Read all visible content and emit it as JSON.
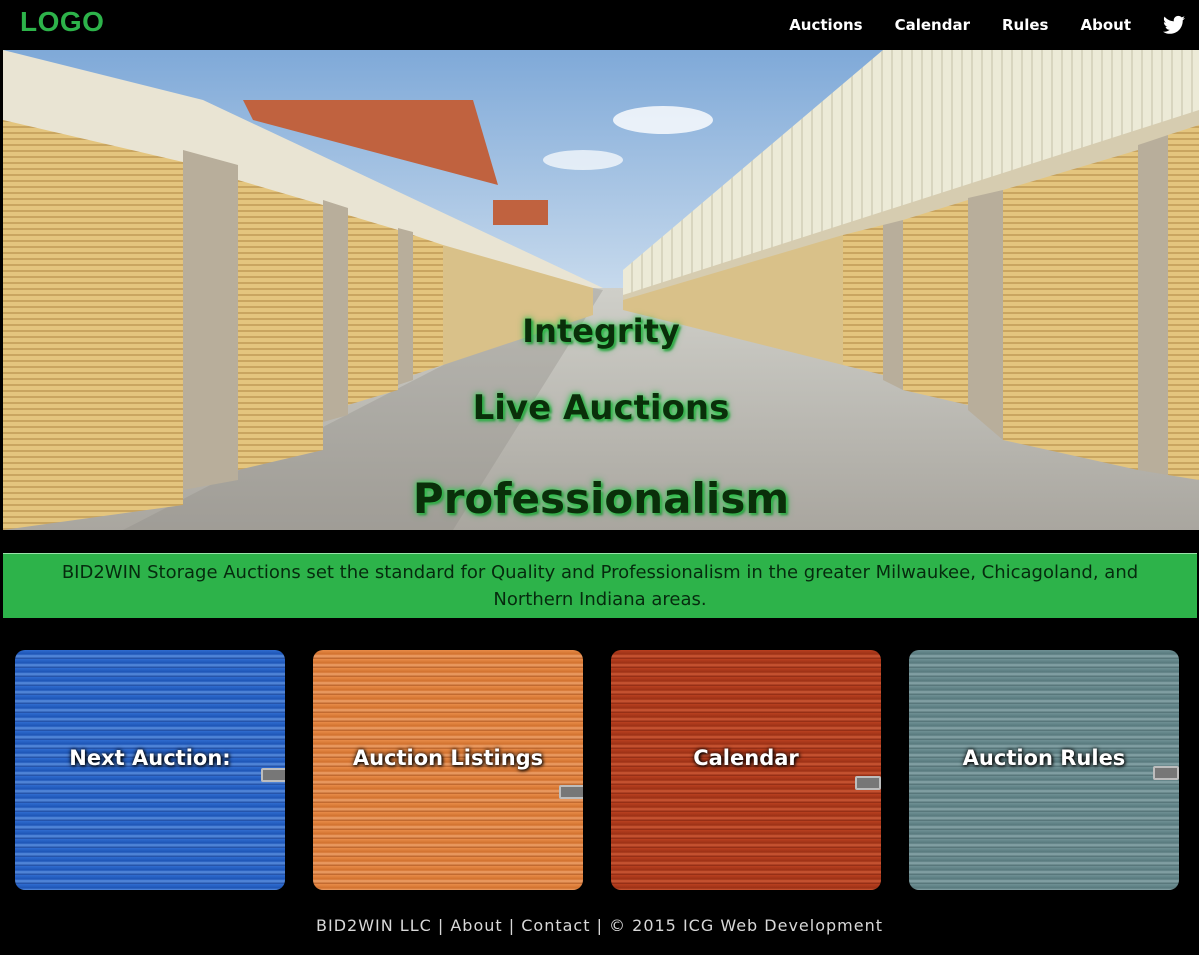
{
  "header": {
    "logo": "LOGO",
    "nav": [
      "Auctions",
      "Calendar",
      "Rules",
      "About"
    ],
    "twitter_icon": "twitter-icon"
  },
  "hero": {
    "line1": "Integrity",
    "line2": "Live Auctions",
    "line3": "Professionalism"
  },
  "banner": {
    "text": "BID2WIN Storage Auctions set the standard for Quality and Professionalism in the greater Milwaukee, Chicagoland, and Northern Indiana areas."
  },
  "tiles": [
    {
      "label": "Next Auction:",
      "color": "#1e55b6"
    },
    {
      "label": "Auction Listings",
      "color": "#d2722f"
    },
    {
      "label": "Calendar",
      "color": "#9c3116"
    },
    {
      "label": "Auction Rules",
      "color": "#587a7e"
    }
  ],
  "footer": {
    "company": "BID2WIN LLC",
    "sep": " | ",
    "about": "About",
    "contact": "Contact",
    "copyright": "© 2015 ICG Web Development"
  },
  "colors": {
    "accent_green": "#2db34a",
    "background": "#000000"
  }
}
